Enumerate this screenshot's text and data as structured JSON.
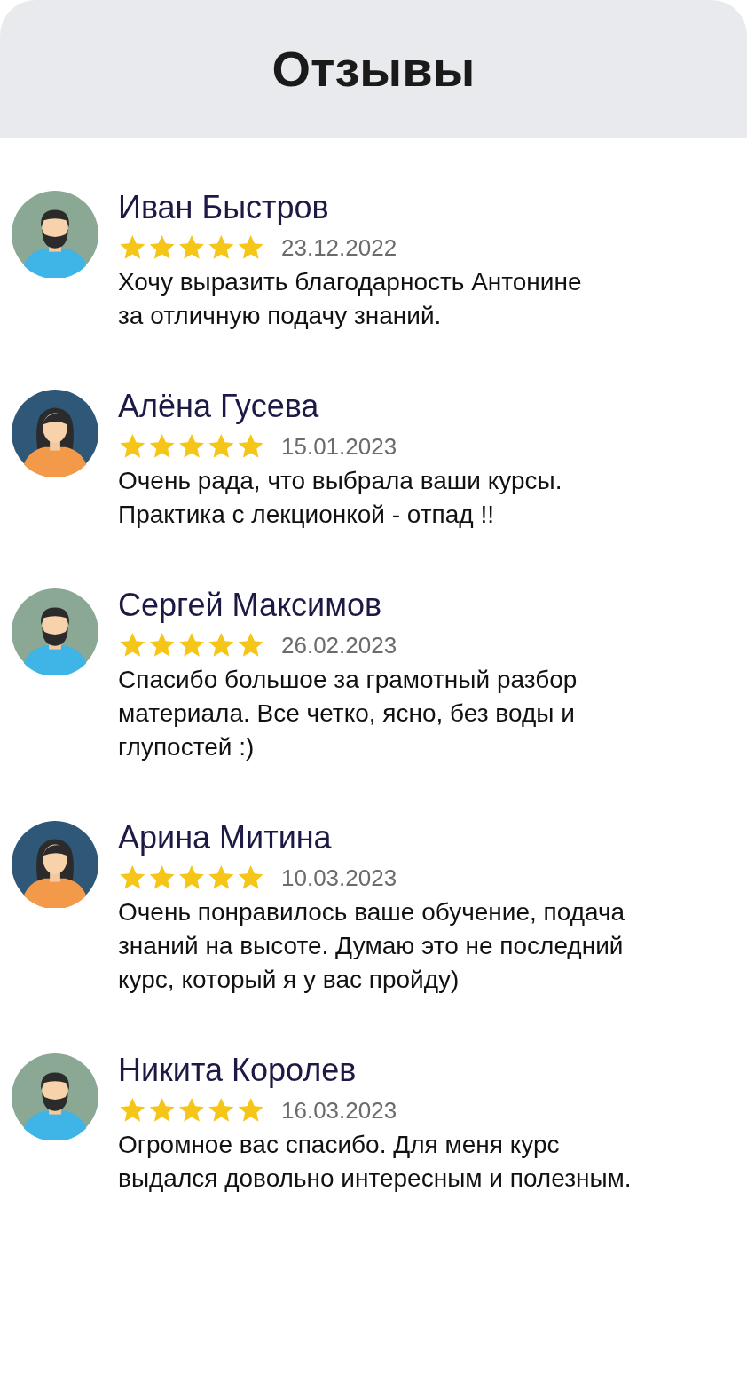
{
  "header": {
    "title": "Отзывы"
  },
  "reviews": [
    {
      "kind": "male",
      "name": "Иван Быстров",
      "stars": 5,
      "date": "23.12.2022",
      "text": "Хочу выразить благодарность Антонине\nза отличную подачу знаний."
    },
    {
      "kind": "female",
      "name": "Алёна Гусева",
      "stars": 5,
      "date": "15.01.2023",
      "text": "Очень рада, что выбрала ваши курсы.\nПрактика с лекционкой - отпад !!"
    },
    {
      "kind": "male",
      "name": "Сергей Максимов",
      "stars": 5,
      "date": "26.02.2023",
      "text": "Спасибо большое за грамотный разбор\nматериала. Все четко, ясно, без воды и\nглупостей :)"
    },
    {
      "kind": "female",
      "name": "Арина Митина",
      "stars": 5,
      "date": "10.03.2023",
      "text": "Очень понравилось ваше обучение, подача\nзнаний на высоте. Думаю это не последний\nкурс, который я у вас пройду)"
    },
    {
      "kind": "male",
      "name": "Никита Королев",
      "stars": 5,
      "date": "16.03.2023",
      "text": "Огромное вас спасибо. Для меня курс\nвыдался довольно интересным и полезным."
    }
  ]
}
